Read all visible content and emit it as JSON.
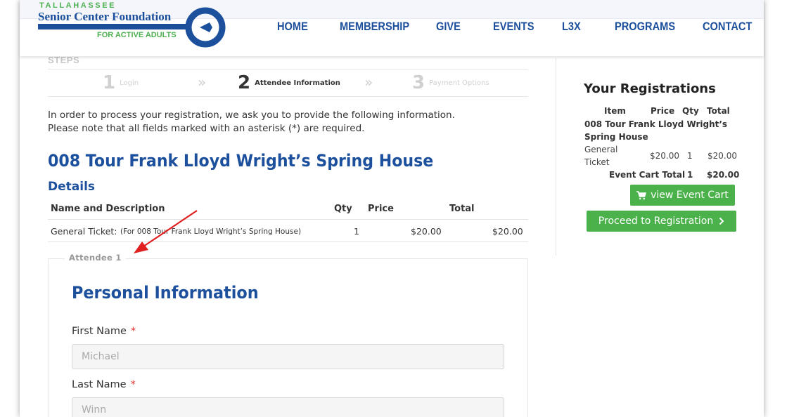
{
  "logo": {
    "line1": "TALLAHASSEE",
    "line2": "Senior Center Foundation",
    "line3": "FOR ACTIVE ADULTS"
  },
  "nav": [
    "HOME",
    "MEMBERSHIP",
    "GIVE",
    "EVENTS",
    "L3X",
    "PROGRAMS",
    "CONTACT"
  ],
  "steps": {
    "label": "STEPS",
    "items": [
      {
        "num": "1",
        "label": "Login"
      },
      {
        "num": "2",
        "label": "Attendee Information"
      },
      {
        "num": "3",
        "label": "Payment Options"
      }
    ],
    "separator": "»"
  },
  "intro": {
    "line1": "In order to process your registration, we ask you to provide the following information.",
    "line2": "Please note that all fields marked with an asterisk (*) are required."
  },
  "event_title": "008 Tour Frank Lloyd Wright’s Spring House",
  "details": {
    "heading": "Details",
    "headers": [
      "Name and Description",
      "Qty",
      "Price",
      "Total"
    ],
    "row": {
      "name": "General Ticket:",
      "desc": "(For 008 Tour Frank Lloyd Wright’s Spring House)",
      "qty": "1",
      "price": "$20.00",
      "total": "$20.00"
    }
  },
  "attendee": {
    "legend": "Attendee 1",
    "section_title": "Personal Information",
    "first_name_label": "First Name",
    "first_name_placeholder": "Michael",
    "last_name_label": "Last Name",
    "last_name_placeholder": "Winn",
    "required_mark": "*"
  },
  "sidebar": {
    "title": "Your Registrations",
    "headers": [
      "Item",
      "Price",
      "Qty",
      "Total"
    ],
    "event_name_1": "008 Tour Frank Lloyd Wright’s",
    "event_name_2": "Spring House",
    "ticket_1": "General",
    "ticket_2": "Ticket",
    "price": "$20.00",
    "qty": "1",
    "total": "$20.00",
    "cart_total_label": "Event Cart Total",
    "cart_total_qty": "1",
    "cart_total": "$20.00",
    "view_cart_label": "view Event Cart",
    "proceed_label": "Proceed to Registration"
  },
  "colors": {
    "brand_blue": "#1c4f9c",
    "brand_green": "#4caf50",
    "button_green": "#4bb14b",
    "required_red": "#e53935",
    "annotation_red": "#e02020"
  }
}
